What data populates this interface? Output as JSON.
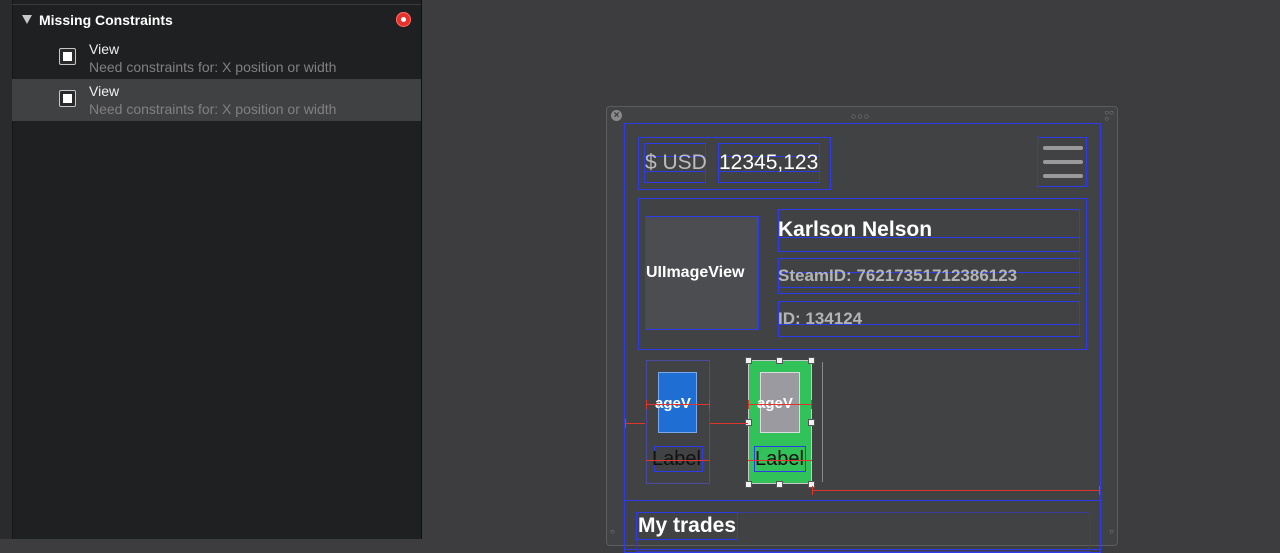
{
  "issues": {
    "section_title": "Missing Constraints",
    "items": [
      {
        "title": "View",
        "description": "Need constraints for: X position or width",
        "selected": false
      },
      {
        "title": "View",
        "description": "Need constraints for: X position or width",
        "selected": true
      }
    ]
  },
  "canvas": {
    "header": {
      "currency": "$ USD",
      "balance": "12345,123"
    },
    "profile": {
      "avatar_placeholder": "UIImageView",
      "name": "Karlson Nelson",
      "steam_id": "SteamID: 76217351712386123",
      "user_id": "ID: 134124"
    },
    "items": [
      {
        "image_placeholder": "ageV",
        "label": "Label"
      },
      {
        "image_placeholder": "ageV",
        "label": "Label"
      }
    ],
    "trades_title": "My trades"
  },
  "colors": {
    "constraint_outline": "#2d3be8",
    "error": "#e5322d",
    "selected_cell": "#31c35a",
    "image_placeholder_blue": "#1f6ed4"
  }
}
